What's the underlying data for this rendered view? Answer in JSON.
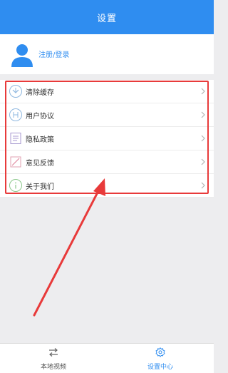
{
  "header": {
    "title": "设置"
  },
  "profile": {
    "login_label": "注册/登录"
  },
  "settings_items": [
    {
      "label": "清除缓存",
      "icon": "clear-cache-icon"
    },
    {
      "label": "用户协议",
      "icon": "user-agreement-icon"
    },
    {
      "label": "隐私政策",
      "icon": "privacy-policy-icon"
    },
    {
      "label": "意见反馈",
      "icon": "feedback-icon"
    },
    {
      "label": "关于我们",
      "icon": "about-us-icon"
    }
  ],
  "bottom_nav": [
    {
      "label": "本地视频",
      "icon": "swap-arrows-icon",
      "active": false
    },
    {
      "label": "设置中心",
      "icon": "gear-icon",
      "active": true
    }
  ],
  "colors": {
    "primary": "#2f8df0",
    "annotation": "#e83a3a",
    "background": "#ededef"
  }
}
